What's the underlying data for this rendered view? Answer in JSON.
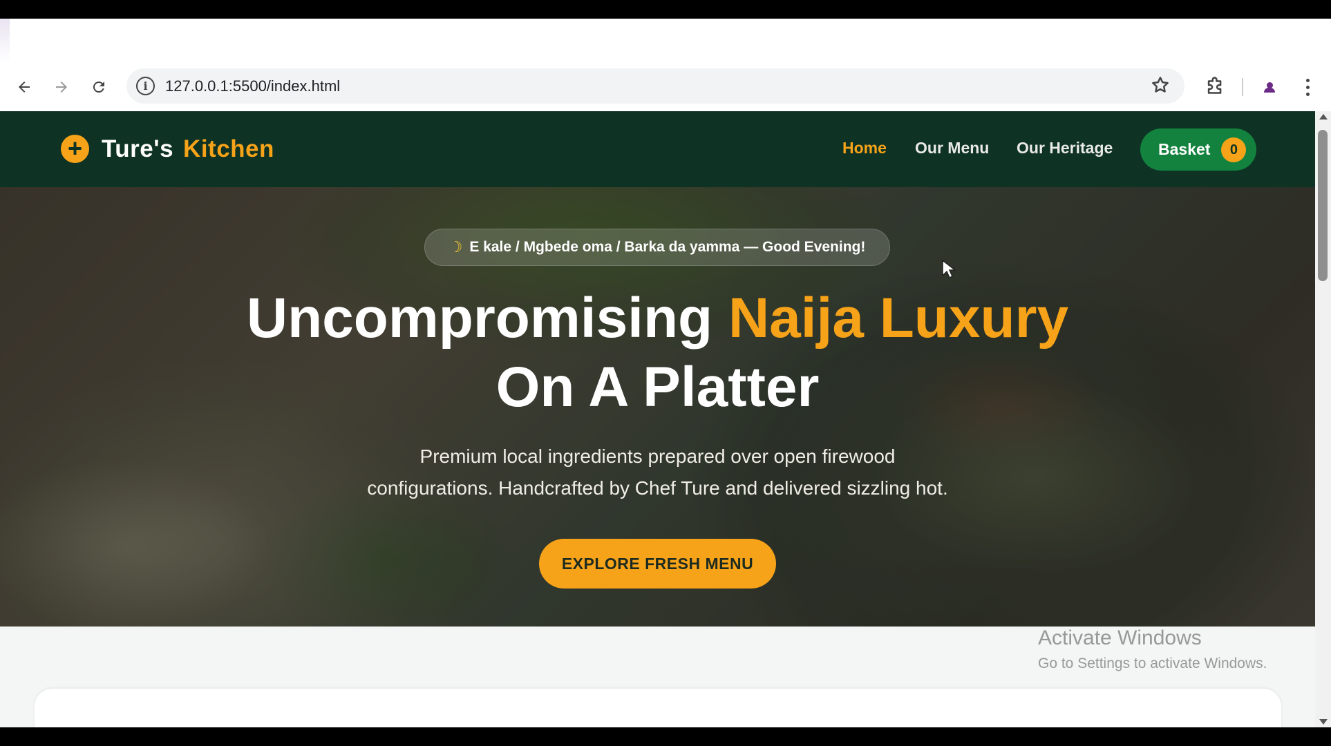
{
  "browser": {
    "url": "127.0.0.1:5500/index.html",
    "back_icon": "arrow-left-icon",
    "forward_icon": "arrow-right-icon",
    "reload_icon": "reload-icon",
    "info_icon": "info-icon",
    "info_glyph": "i",
    "bookmark_icon": "star-icon",
    "extensions_icon": "puzzle-icon",
    "profile_icon": "person-icon",
    "menu_icon": "more-vertical-icon"
  },
  "site": {
    "logo_symbol": "+",
    "logo_name": "Ture's",
    "logo_accent": "Kitchen",
    "nav": {
      "home": "Home",
      "menu": "Our Menu",
      "heritage": "Our Heritage"
    },
    "basket_label": "Basket",
    "basket_count": "0"
  },
  "hero": {
    "greeting": "E kale / Mgbede oma / Barka da yamma — Good Evening!",
    "greeting_icon": "moon-icon",
    "headline_1": "Uncompromising",
    "headline_1_accent": "Naija Luxury",
    "headline_2": "On A Platter",
    "subcopy_1": "Premium local ingredients prepared over open firewood",
    "subcopy_2": "configurations. Handcrafted by Chef Ture and delivered sizzling hot.",
    "cta": "EXPLORE FRESH MENU"
  },
  "os_watermark": {
    "title": "Activate Windows",
    "subtitle": "Go to Settings to activate Windows."
  },
  "colors": {
    "header_bg": "#0e3223",
    "accent": "#f7a319",
    "basket_bg": "#13823e"
  }
}
